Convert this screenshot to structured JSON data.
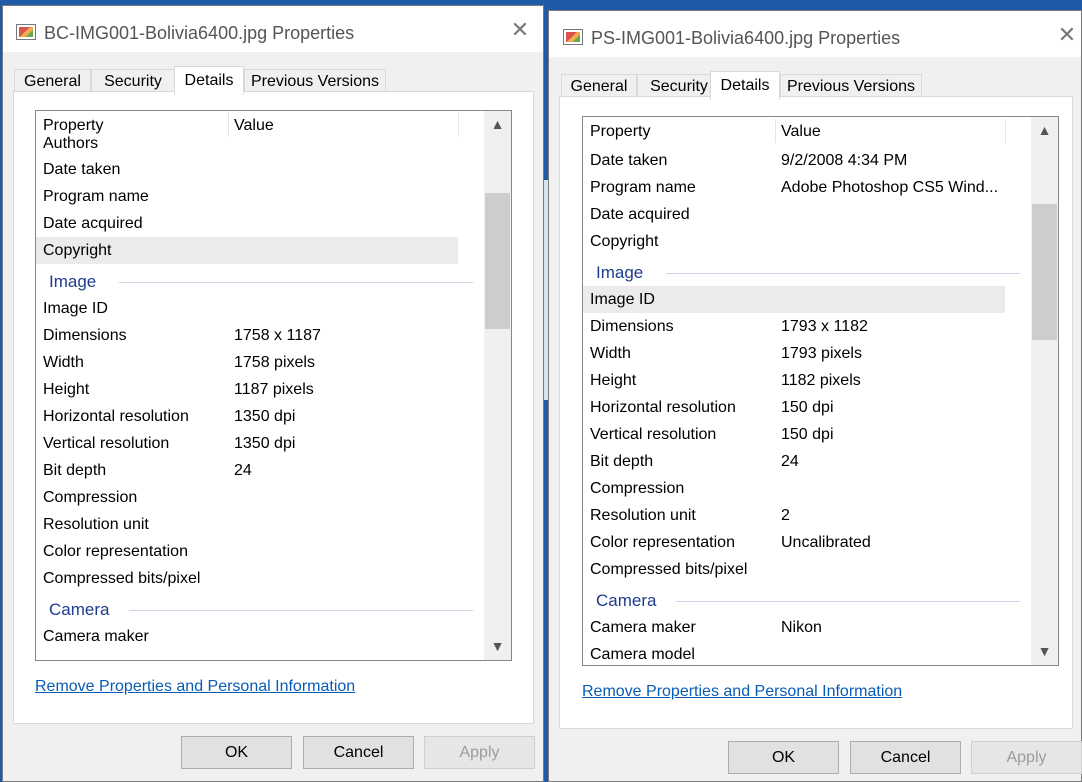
{
  "dialogs": [
    {
      "title": "BC-IMG001-Bolivia6400.jpg Properties",
      "tabs": [
        "General",
        "Security",
        "Details",
        "Previous Versions"
      ],
      "active_tab": "Details",
      "columns": {
        "property": "Property",
        "value": "Value"
      },
      "overlap_label": "Authors",
      "rows": [
        {
          "kind": "prop",
          "name": "Date taken",
          "value": ""
        },
        {
          "kind": "prop",
          "name": "Program name",
          "value": ""
        },
        {
          "kind": "prop",
          "name": "Date acquired",
          "value": ""
        },
        {
          "kind": "prop",
          "name": "Copyright",
          "value": "",
          "selected": true
        },
        {
          "kind": "group",
          "name": "Image"
        },
        {
          "kind": "prop",
          "name": "Image ID",
          "value": ""
        },
        {
          "kind": "prop",
          "name": "Dimensions",
          "value": "1758 x 1187"
        },
        {
          "kind": "prop",
          "name": "Width",
          "value": "1758 pixels"
        },
        {
          "kind": "prop",
          "name": "Height",
          "value": "1187 pixels"
        },
        {
          "kind": "prop",
          "name": "Horizontal resolution",
          "value": "1350 dpi"
        },
        {
          "kind": "prop",
          "name": "Vertical resolution",
          "value": "1350 dpi"
        },
        {
          "kind": "prop",
          "name": "Bit depth",
          "value": "24"
        },
        {
          "kind": "prop",
          "name": "Compression",
          "value": ""
        },
        {
          "kind": "prop",
          "name": "Resolution unit",
          "value": ""
        },
        {
          "kind": "prop",
          "name": "Color representation",
          "value": ""
        },
        {
          "kind": "prop",
          "name": "Compressed bits/pixel",
          "value": ""
        },
        {
          "kind": "group",
          "name": "Camera"
        },
        {
          "kind": "prop",
          "name": "Camera maker",
          "value": ""
        }
      ],
      "remove_link": "Remove Properties and Personal Information",
      "buttons": {
        "ok": "OK",
        "cancel": "Cancel",
        "apply": "Apply"
      },
      "close_glyph": "✕"
    },
    {
      "title": "PS-IMG001-Bolivia6400.jpg Properties",
      "tabs": [
        "General",
        "Security",
        "Details",
        "Previous Versions"
      ],
      "active_tab": "Details",
      "columns": {
        "property": "Property",
        "value": "Value"
      },
      "overlap_label": "",
      "rows": [
        {
          "kind": "prop",
          "name": "Date taken",
          "value": "9/2/2008 4:34 PM"
        },
        {
          "kind": "prop",
          "name": "Program name",
          "value": "Adobe Photoshop CS5 Wind..."
        },
        {
          "kind": "prop",
          "name": "Date acquired",
          "value": ""
        },
        {
          "kind": "prop",
          "name": "Copyright",
          "value": ""
        },
        {
          "kind": "group",
          "name": "Image"
        },
        {
          "kind": "prop",
          "name": "Image ID",
          "value": "",
          "selected": true
        },
        {
          "kind": "prop",
          "name": "Dimensions",
          "value": "1793 x 1182"
        },
        {
          "kind": "prop",
          "name": "Width",
          "value": "1793 pixels"
        },
        {
          "kind": "prop",
          "name": "Height",
          "value": "1182 pixels"
        },
        {
          "kind": "prop",
          "name": "Horizontal resolution",
          "value": "150 dpi"
        },
        {
          "kind": "prop",
          "name": "Vertical resolution",
          "value": "150 dpi"
        },
        {
          "kind": "prop",
          "name": "Bit depth",
          "value": "24"
        },
        {
          "kind": "prop",
          "name": "Compression",
          "value": ""
        },
        {
          "kind": "prop",
          "name": "Resolution unit",
          "value": "2"
        },
        {
          "kind": "prop",
          "name": "Color representation",
          "value": "Uncalibrated"
        },
        {
          "kind": "prop",
          "name": "Compressed bits/pixel",
          "value": ""
        },
        {
          "kind": "group",
          "name": "Camera"
        },
        {
          "kind": "prop",
          "name": "Camera maker",
          "value": "Nikon"
        },
        {
          "kind": "prop",
          "name": "Camera model",
          "value": ""
        }
      ],
      "remove_link": "Remove Properties and Personal Information",
      "buttons": {
        "ok": "OK",
        "cancel": "Cancel",
        "apply": "Apply"
      },
      "close_glyph": "✕"
    }
  ],
  "icons": {
    "scroll_up": "▲",
    "scroll_down": "▼",
    "close": "close-icon",
    "file": "image-file-icon"
  },
  "colors": {
    "link": "#0a5bb5",
    "group_header": "#1e3c8c",
    "selection": "#ebebeb",
    "desktop": "#1e5aa8"
  }
}
